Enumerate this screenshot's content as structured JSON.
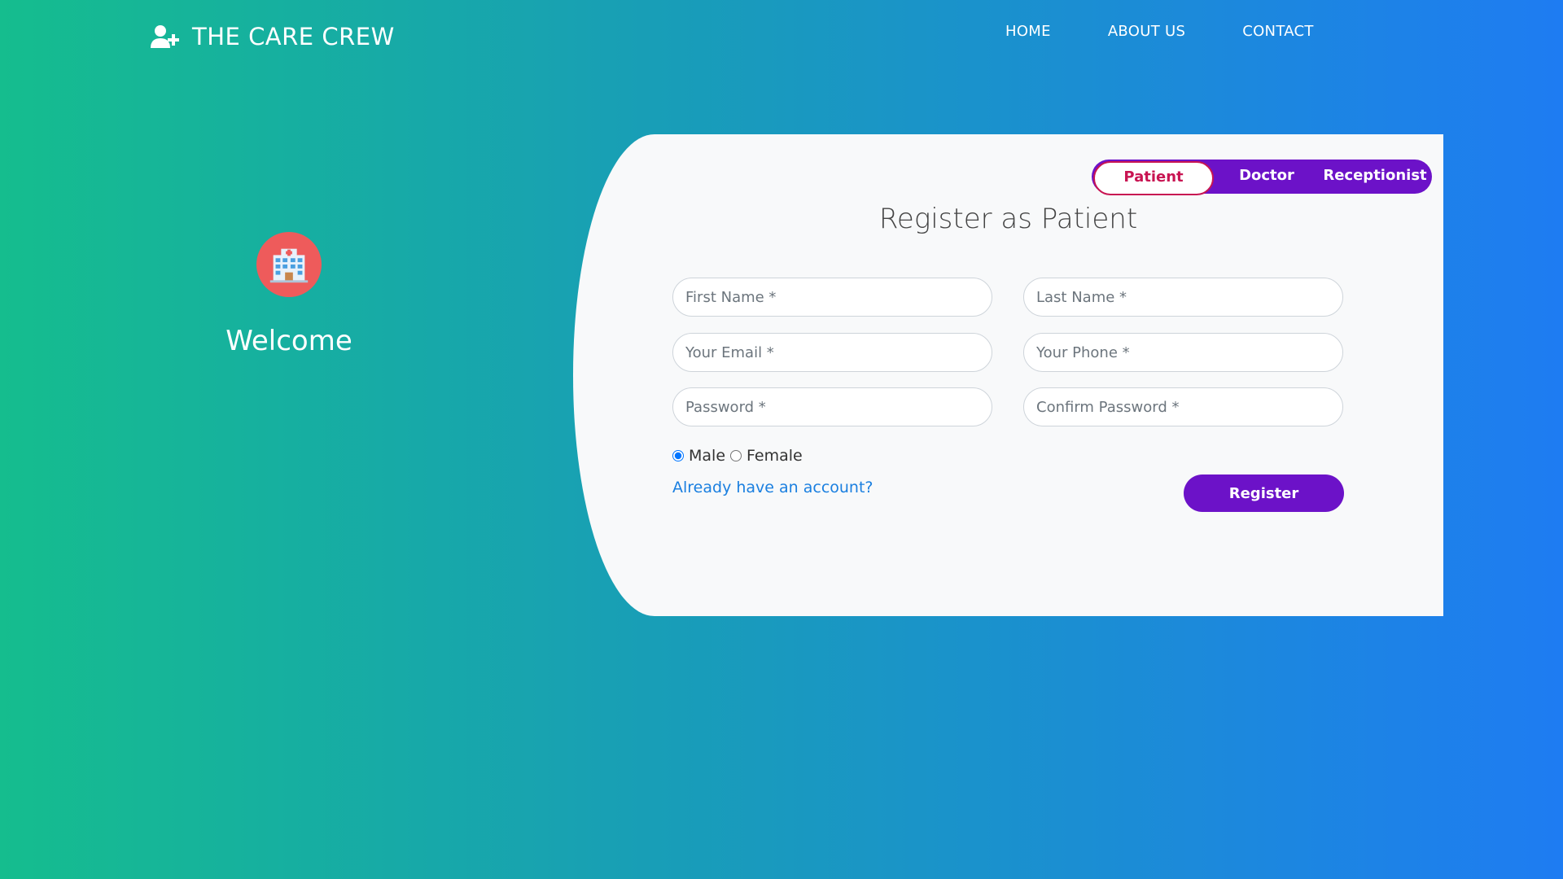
{
  "brand": {
    "title": "THE CARE CREW",
    "icon": "user-plus-icon"
  },
  "nav": {
    "home": "HOME",
    "about": "ABOUT US",
    "contact": "CONTACT"
  },
  "welcome": {
    "icon": "hospital-icon",
    "text": "Welcome"
  },
  "toggle": {
    "patient": "Patient",
    "doctor": "Doctor",
    "receptionist": "Receptionist",
    "active": "Patient"
  },
  "form": {
    "title": "Register as Patient",
    "first_name": "First Name *",
    "last_name": "Last Name *",
    "email": "Your Email *",
    "phone": "Your Phone *",
    "password": "Password *",
    "confirm_password": "Confirm Password *",
    "male": "Male",
    "female": "Female",
    "gender_selected": "Male",
    "login_link": "Already have an account?",
    "register": "Register"
  },
  "colors": {
    "gradient_start": "#15bd8e",
    "gradient_end": "#1e7cf2",
    "accent_purple": "#6c12c8",
    "active_toggle": "#c81452",
    "link_blue": "#1a7fe0",
    "hospital_red": "#ee5b5b"
  }
}
